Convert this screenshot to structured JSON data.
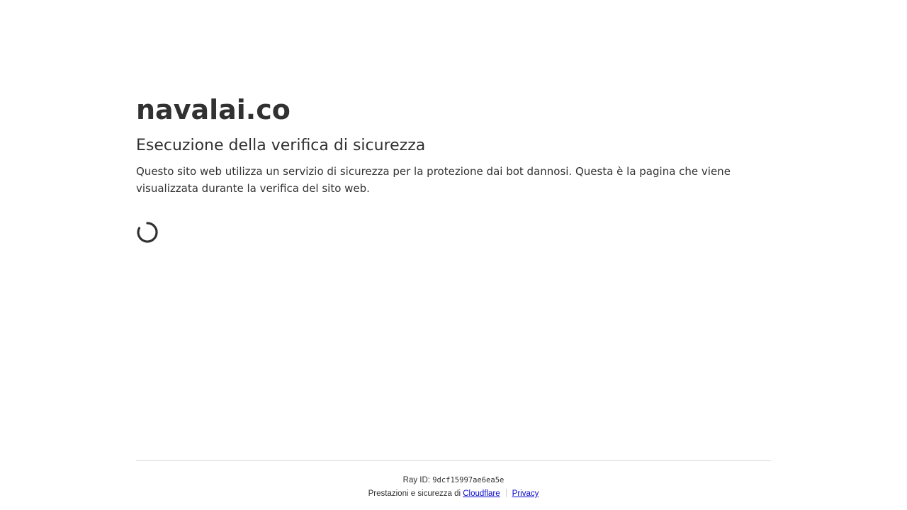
{
  "site": {
    "domain": "navalai.co"
  },
  "challenge": {
    "heading": "Esecuzione della verifica di sicurezza",
    "description": "Questo sito web utilizza un servizio di sicurezza per la protezione dai bot dannosi. Questa è la pagina che viene visualizzata durante la verifica del sito web.",
    "spinner_icon": "loading-spinner-icon"
  },
  "footer": {
    "ray_label": "Ray ID: ",
    "ray_id": "9dcf15997ae6ea5e",
    "performance_prefix": "Prestazioni e sicurezza di ",
    "cloudflare_link": "Cloudflare",
    "privacy_link": "Privacy"
  },
  "colors": {
    "text": "#313131",
    "link": "#0a0acc",
    "divider": "#d9d9d9"
  }
}
